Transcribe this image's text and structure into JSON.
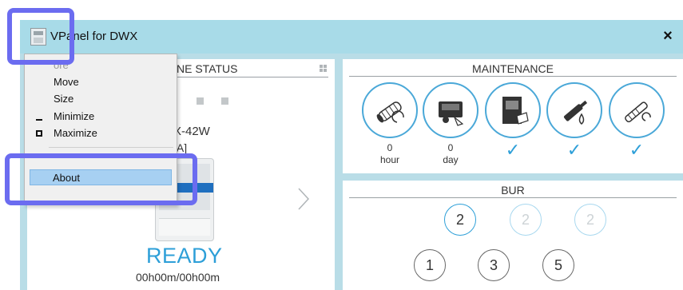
{
  "window": {
    "title": "VPanel for DWX",
    "close_label": "×"
  },
  "status_panel": {
    "title": "MACHINE STATUS",
    "title_visible": "NE STATUS",
    "model": "X-42W",
    "model_sub": "[A]",
    "state": "READY",
    "time": "00h00m/00h00m"
  },
  "maintenance_panel": {
    "title": "MAINTENANCE",
    "items": [
      {
        "icon": "spindle-icon",
        "value": "0",
        "unit": "hour",
        "check": ""
      },
      {
        "icon": "machine-cleaning-icon",
        "value": "0",
        "unit": "day",
        "check": ""
      },
      {
        "icon": "door-cleaning-icon",
        "value": "",
        "unit": "",
        "check": "✓"
      },
      {
        "icon": "oil-icon",
        "value": "",
        "unit": "",
        "check": "✓"
      },
      {
        "icon": "air-hose-icon",
        "value": "",
        "unit": "",
        "check": "✓"
      }
    ]
  },
  "bur_panel": {
    "title": "BUR",
    "top_row": [
      "2",
      "2",
      "2"
    ],
    "bottom_row": [
      "1",
      "3",
      "5"
    ]
  },
  "system_menu": {
    "items": [
      {
        "label": "Restore",
        "visible_label": "ore",
        "enabled": false
      },
      {
        "label": "Move",
        "enabled": true
      },
      {
        "label": "Size",
        "enabled": true
      },
      {
        "label": "Minimize",
        "enabled": true
      },
      {
        "label": "Maximize",
        "enabled": true
      },
      {
        "label": "About",
        "enabled": true,
        "selected": true
      }
    ]
  },
  "colors": {
    "title_bar": "#a8dbe8",
    "accent": "#2d9fd8",
    "highlight": "#6b6cf0"
  }
}
